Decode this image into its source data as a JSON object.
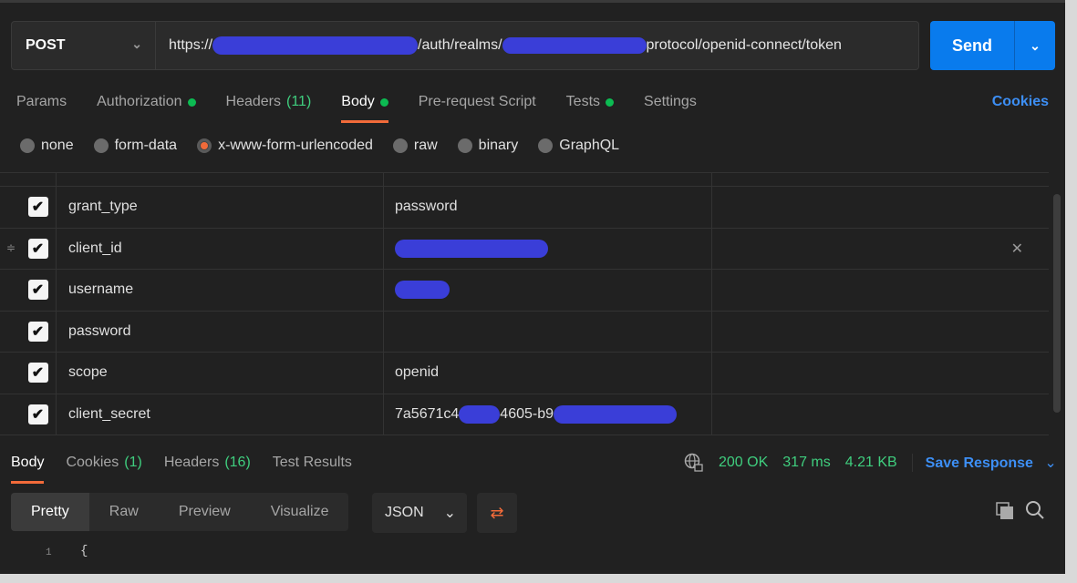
{
  "request": {
    "method": "POST",
    "url_prefix": "https://",
    "url_mid": "/auth/realms/",
    "url_suffix": "protocol/openid-connect/token",
    "send_label": "Send"
  },
  "req_tabs": [
    {
      "label": "Params"
    },
    {
      "label": "Authorization",
      "dot": true
    },
    {
      "label": "Headers",
      "count": "(11)"
    },
    {
      "label": "Body",
      "dot": true,
      "active": true
    },
    {
      "label": "Pre-request Script"
    },
    {
      "label": "Tests",
      "dot": true
    },
    {
      "label": "Settings"
    }
  ],
  "cookies_label": "Cookies",
  "body_types": [
    {
      "label": "none"
    },
    {
      "label": "form-data"
    },
    {
      "label": "x-www-form-urlencoded",
      "selected": true
    },
    {
      "label": "raw"
    },
    {
      "label": "binary"
    },
    {
      "label": "GraphQL"
    }
  ],
  "params": [
    {
      "key": "grant_type",
      "value": "password",
      "checked": true
    },
    {
      "key": "client_id",
      "value": "",
      "redacted": true,
      "checked": true
    },
    {
      "key": "username",
      "value": "",
      "redacted": true,
      "checked": true
    },
    {
      "key": "password",
      "value": "",
      "redacted": true,
      "checked": true
    },
    {
      "key": "scope",
      "value": "openid",
      "checked": true
    },
    {
      "key": "client_secret",
      "value": "7a5671c4",
      "value2": "4605-b9",
      "redacted": true,
      "checked": true
    }
  ],
  "resp_tabs": [
    {
      "label": "Body",
      "active": true
    },
    {
      "label": "Cookies",
      "count": "(1)"
    },
    {
      "label": "Headers",
      "count": "(16)"
    },
    {
      "label": "Test Results"
    }
  ],
  "status": {
    "code": "200 OK",
    "time": "317 ms",
    "size": "4.21 KB",
    "save_label": "Save Response"
  },
  "view_tabs": [
    "Pretty",
    "Raw",
    "Preview",
    "Visualize"
  ],
  "format": "JSON",
  "editor": {
    "line": "1",
    "text": "{"
  },
  "colors": {
    "accent": "#f26b3a",
    "send": "#097bed",
    "link": "#3d8ff5",
    "success": "#3fce7e",
    "redaction": "#3a3ed8"
  }
}
